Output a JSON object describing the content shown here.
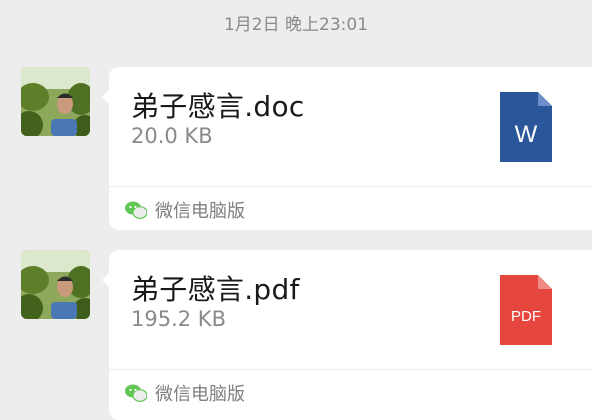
{
  "timestamp": "1月2日 晚上23:01",
  "messages": [
    {
      "file_name": "弟子感言.doc",
      "file_size": "20.0 KB",
      "file_icon": "word-document-icon",
      "file_icon_label": "W",
      "file_icon_color": "#2b579a",
      "source_label": "微信电脑版",
      "source_icon": "wechat-icon"
    },
    {
      "file_name": "弟子感言.pdf",
      "file_size": "195.2 KB",
      "file_icon": "pdf-document-icon",
      "file_icon_label": "PDF",
      "file_icon_color": "#e5463d",
      "source_label": "微信电脑版",
      "source_icon": "wechat-icon"
    }
  ],
  "colors": {
    "background": "#ededed",
    "bubble": "#ffffff",
    "wechat_green": "#62c655"
  }
}
